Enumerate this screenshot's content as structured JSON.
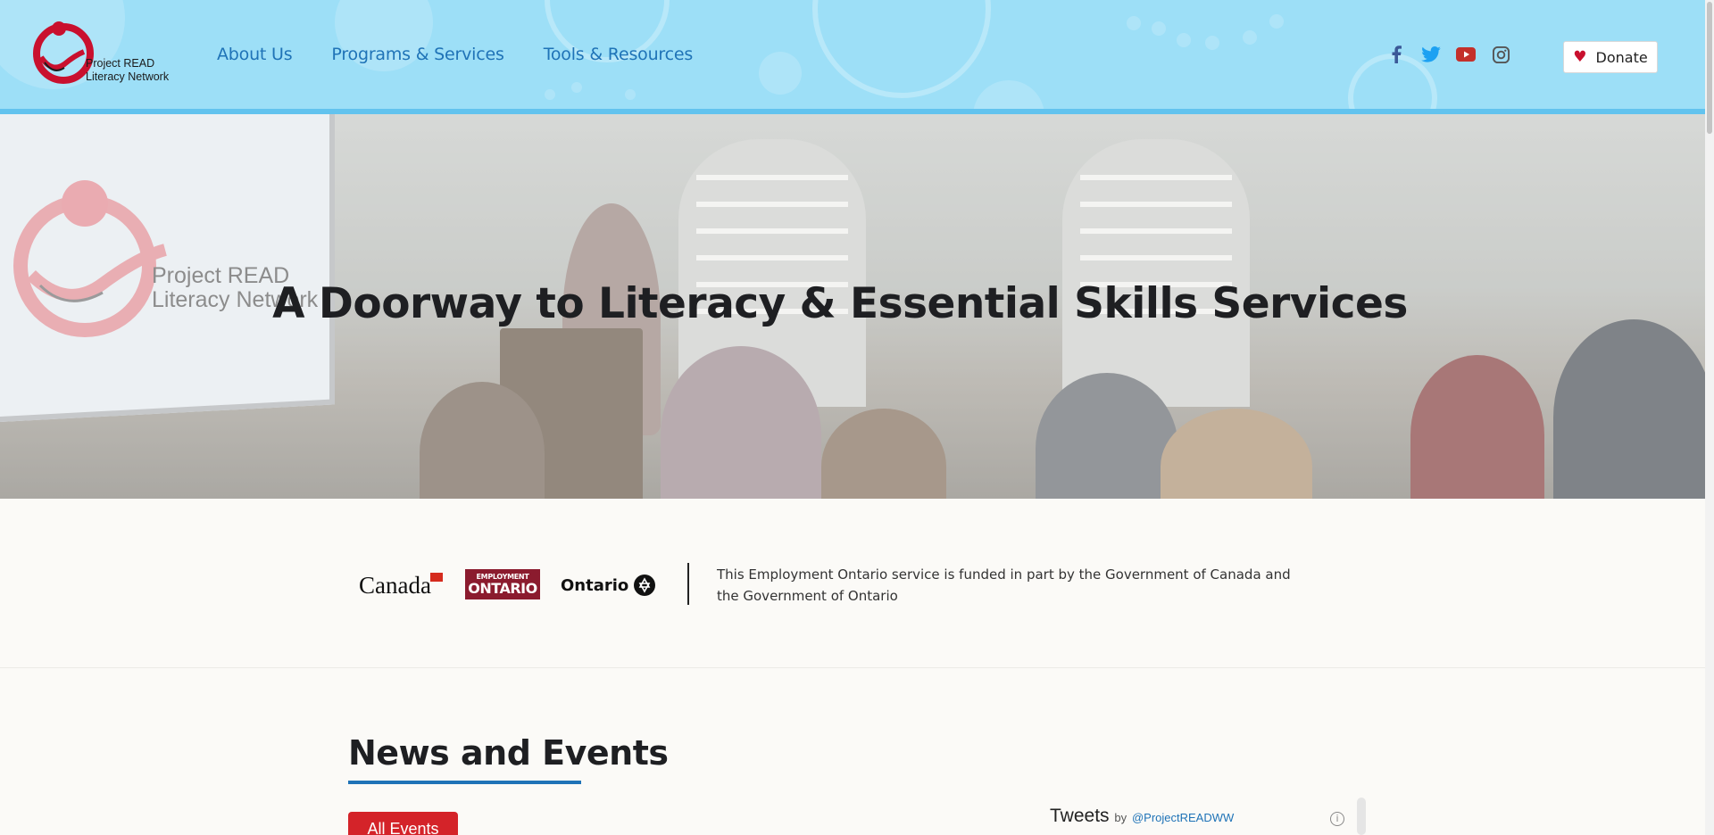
{
  "header": {
    "logo_text_line1": "Project READ",
    "logo_text_line2": "Literacy Network",
    "nav": [
      {
        "label": "About Us"
      },
      {
        "label": "Programs & Services"
      },
      {
        "label": "Tools & Resources"
      }
    ],
    "social": [
      {
        "icon": "facebook-icon",
        "color": "#3b5998"
      },
      {
        "icon": "twitter-icon",
        "color": "#1da1f2"
      },
      {
        "icon": "youtube-icon",
        "color": "#c4302b"
      },
      {
        "icon": "instagram-icon",
        "color": "#555555"
      }
    ],
    "donate_label": "Donate",
    "background_color": "#9ddff7",
    "accent_color": "#1f73b7"
  },
  "hero": {
    "title": "A Doorway to Literacy & Essential Skills Services",
    "logo_text_line1": "Project READ",
    "logo_text_line2": "Literacy Network"
  },
  "funding": {
    "canada_label": "Canada",
    "eo_label_small": "EMPLOYMENT",
    "eo_label_big": "ONTARIO",
    "ontario_label": "Ontario",
    "text": "This Employment Ontario service is funded in part by the Government of Canada and the Government of Ontario"
  },
  "news": {
    "title": "News and Events",
    "all_events_label": "All Events",
    "tweets_label": "Tweets",
    "tweets_by": "by",
    "tweets_handle": "@ProjectREADWW",
    "button_color": "#d42329"
  }
}
